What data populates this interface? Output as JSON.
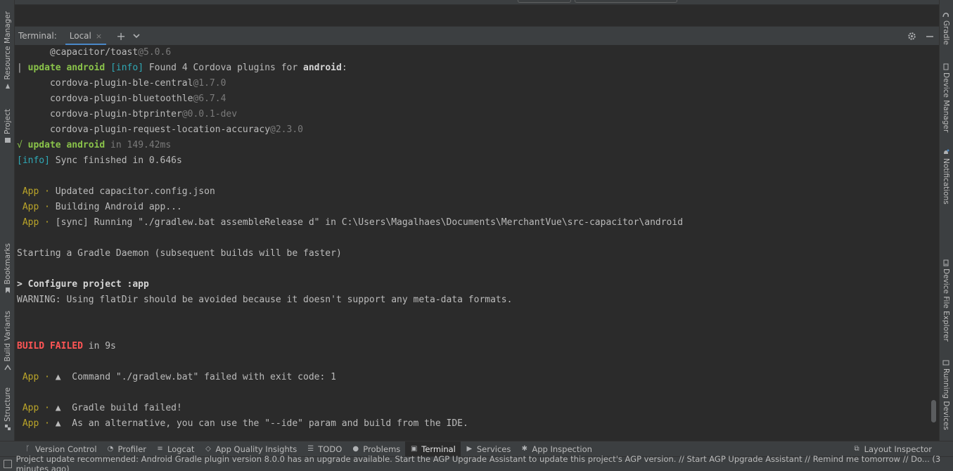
{
  "left_tabs": [
    {
      "label": "Resource Manager",
      "icon": "resource-manager-icon"
    },
    {
      "label": "Project",
      "icon": "folder-icon"
    },
    {
      "label": "Bookmarks",
      "icon": "bookmark-icon"
    },
    {
      "label": "Build Variants",
      "icon": "build-variants-icon"
    },
    {
      "label": "Structure",
      "icon": "structure-icon"
    }
  ],
  "right_tabs": [
    {
      "label": "Gradle",
      "icon": "gradle-icon"
    },
    {
      "label": "Device Manager",
      "icon": "device-manager-icon"
    },
    {
      "label": "Notifications",
      "icon": "bell-icon"
    },
    {
      "label": "Device File Explorer",
      "icon": "device-file-icon"
    },
    {
      "label": "Running Devices",
      "icon": "running-devices-icon"
    }
  ],
  "terminal": {
    "title": "Terminal:",
    "tab_label": "Local",
    "close_glyph": "×",
    "add_glyph": "+",
    "lines": {
      "l1_a": "      @capacitor/toast",
      "l1_b": "@5.0.6",
      "l2_a": "| ",
      "l2_b": "update android",
      "l2_c": "[info]",
      "l2_d": " Found 4 Cordova plugins for ",
      "l2_e": "android",
      "l2_f": ":",
      "l3_a": "      cordova-plugin-ble-central",
      "l3_b": "@1.7.0",
      "l4_a": "      cordova-plugin-bluetoothle",
      "l4_b": "@6.7.4",
      "l5_a": "      cordova-plugin-btprinter",
      "l5_b": "@0.0.1-dev",
      "l6_a": "      cordova-plugin-request-location-accuracy",
      "l6_b": "@2.3.0",
      "l7_a": "√ ",
      "l7_b": "update android",
      "l7_c": " in 149.42ms",
      "l8_a": "[info]",
      "l8_b": " Sync finished in 0.646s",
      "app": "App",
      "dot": " · ",
      "warn": "▲",
      "l9": "Updated capacitor.config.json",
      "l10": "Building Android app...",
      "l11": "[sync] Running \"./gradlew.bat assembleRelease d\" in C:\\Users\\Magalhaes\\Documents\\MerchantVue\\src-capacitor\\android",
      "l12": "Starting a Gradle Daemon (subsequent builds will be faster)",
      "l13": "> Configure project :app",
      "l14": "WARNING: Using flatDir should be avoided because it doesn't support any meta-data formats.",
      "l15_a": "BUILD FAILED",
      "l15_b": " in 9s",
      "l16": "  Command \"./gradlew.bat\" failed with exit code: 1",
      "l17": "  Gradle build failed!",
      "l18": "  As an alternative, you can use the \"--ide\" param and build from the IDE."
    }
  },
  "bottom_bar": {
    "items": [
      {
        "label": "Version Control",
        "icon": "version-control-icon"
      },
      {
        "label": "Profiler",
        "icon": "profiler-icon"
      },
      {
        "label": "Logcat",
        "icon": "logcat-icon"
      },
      {
        "label": "App Quality Insights",
        "icon": "app-quality-icon"
      },
      {
        "label": "TODO",
        "icon": "todo-icon"
      },
      {
        "label": "Problems",
        "icon": "problems-icon"
      },
      {
        "label": "Terminal",
        "icon": "terminal-icon",
        "active": true
      },
      {
        "label": "Services",
        "icon": "services-icon"
      },
      {
        "label": "App Inspection",
        "icon": "app-inspection-icon"
      }
    ],
    "right_item": {
      "label": "Layout Inspector",
      "icon": "layout-inspector-icon"
    }
  },
  "status_bar": {
    "message": "Project update recommended: Android Gradle plugin version 8.0.0 has an upgrade available.  Start the AGP Upgrade Assistant to update this project's AGP version. // Start AGP Upgrade Assistant // Remind me tomorrow // Do... (3 minutes ago)"
  },
  "colors": {
    "background": "#2b2b2b",
    "panel": "#3c3f41",
    "accent": "#4a88c7",
    "green": "#8ac34a",
    "cyan": "#2fa9b6",
    "error": "#ff5555",
    "app_tag": "#bba529"
  }
}
